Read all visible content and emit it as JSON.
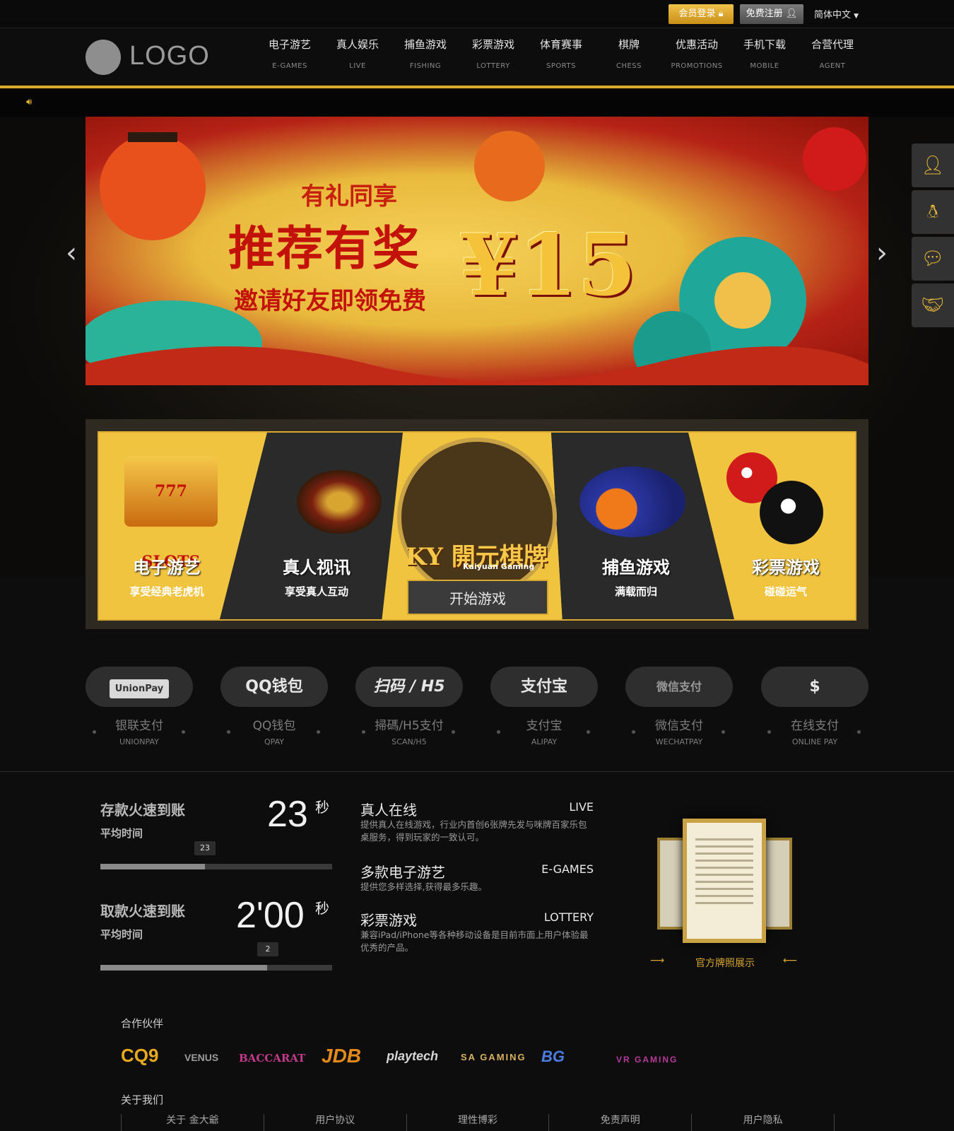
{
  "topbar": {
    "login": "会员登录",
    "register": "免费注册",
    "language": "简体中文"
  },
  "logo": {
    "text": "LOGO"
  },
  "nav": [
    {
      "cn": "电子游艺",
      "en": "E-GAMES"
    },
    {
      "cn": "真人娱乐",
      "en": "LIVE"
    },
    {
      "cn": "捕鱼游戏",
      "en": "FISHING"
    },
    {
      "cn": "彩票游戏",
      "en": "LOTTERY"
    },
    {
      "cn": "体育赛事",
      "en": "SPORTS"
    },
    {
      "cn": "棋牌",
      "en": "CHESS"
    },
    {
      "cn": "优惠活动",
      "en": "PROMOTIONS"
    },
    {
      "cn": "手机下载",
      "en": "MOBILE"
    },
    {
      "cn": "合营代理",
      "en": "AGENT"
    }
  ],
  "banner": {
    "line1": "有礼同享",
    "line2": "推荐有奖",
    "line3": "邀请好友即领免费",
    "amount": "¥15"
  },
  "sidebar_icons": [
    "customer-service-icon",
    "qq-icon",
    "wechat-icon",
    "handshake-icon"
  ],
  "games": [
    {
      "title": "电子游艺",
      "sub": "享受经典老虎机",
      "badge": "777 SLOTS"
    },
    {
      "title": "真人视讯",
      "sub": "享受真人互动"
    },
    {
      "brand": "開元棋牌",
      "brand_prefix": "KY",
      "brand_en": "Kaiyuan Gaming",
      "button": "开始游戏"
    },
    {
      "title": "捕鱼游戏",
      "sub": "满载而归"
    },
    {
      "title": "彩票游戏",
      "sub": "碰碰运气"
    }
  ],
  "payments": [
    {
      "pill": "UnionPay",
      "cn": "银联支付",
      "en": "UNIONPAY"
    },
    {
      "pill": "QQ钱包",
      "cn": "QQ钱包",
      "en": "QPAY"
    },
    {
      "pill": "扫码 / H5",
      "cn": "掃碼/H5支付",
      "en": "SCAN/H5"
    },
    {
      "pill": "支付宝",
      "cn": "支付宝",
      "en": "ALIPAY"
    },
    {
      "pill": "微信支付",
      "cn": "微信支付",
      "en": "WECHATPAY"
    },
    {
      "pill": "$",
      "cn": "在线支付",
      "en": "ONLINE PAY"
    }
  ],
  "stats": {
    "deposit": {
      "title": "存款火速到账",
      "sub": "平均时间",
      "value": "23",
      "unit": "秒",
      "tip": "23",
      "progress": 0.45
    },
    "withdraw": {
      "title": "取款火速到账",
      "sub": "平均时间",
      "value": "2'00",
      "unit": "秒",
      "tip": "2",
      "progress": 0.72
    }
  },
  "features": [
    {
      "title": "真人在线",
      "en": "LIVE",
      "desc": "提供真人在线游戏，行业内首创6张牌先发与咪牌百家乐包桌服务，得到玩家的一致认可。"
    },
    {
      "title": "多款电子游艺",
      "en": "E-GAMES",
      "desc": "提供您多样选择,获得最多乐趣。"
    },
    {
      "title": "彩票游戏",
      "en": "LOTTERY",
      "desc": "兼容iPad/iPhone等各种移动设备是目前市面上用户体验最优秀的产品。"
    }
  ],
  "license": {
    "label": "官方牌照展示"
  },
  "partners": {
    "heading": "合作伙伴",
    "items": [
      {
        "name": "CQ9",
        "color": "#e7a91e"
      },
      {
        "name": "VENUS",
        "color": "#9c9c9c"
      },
      {
        "name": "BACCARAT",
        "color": "#c23a8a"
      },
      {
        "name": "JDB",
        "color": "#e38a1a"
      },
      {
        "name": "playtech",
        "color": "#d6d6d6"
      },
      {
        "name": "SA GAMING",
        "color": "#d8b160"
      },
      {
        "name": "BG",
        "color": "#4a7de0"
      },
      {
        "name": "VR GAMING",
        "color": "#b63a9a"
      }
    ]
  },
  "about": {
    "heading": "关于我们",
    "links": [
      "关于 金大爺",
      "用户协议",
      "理性博彩",
      "免责声明",
      "用户隐私"
    ]
  }
}
